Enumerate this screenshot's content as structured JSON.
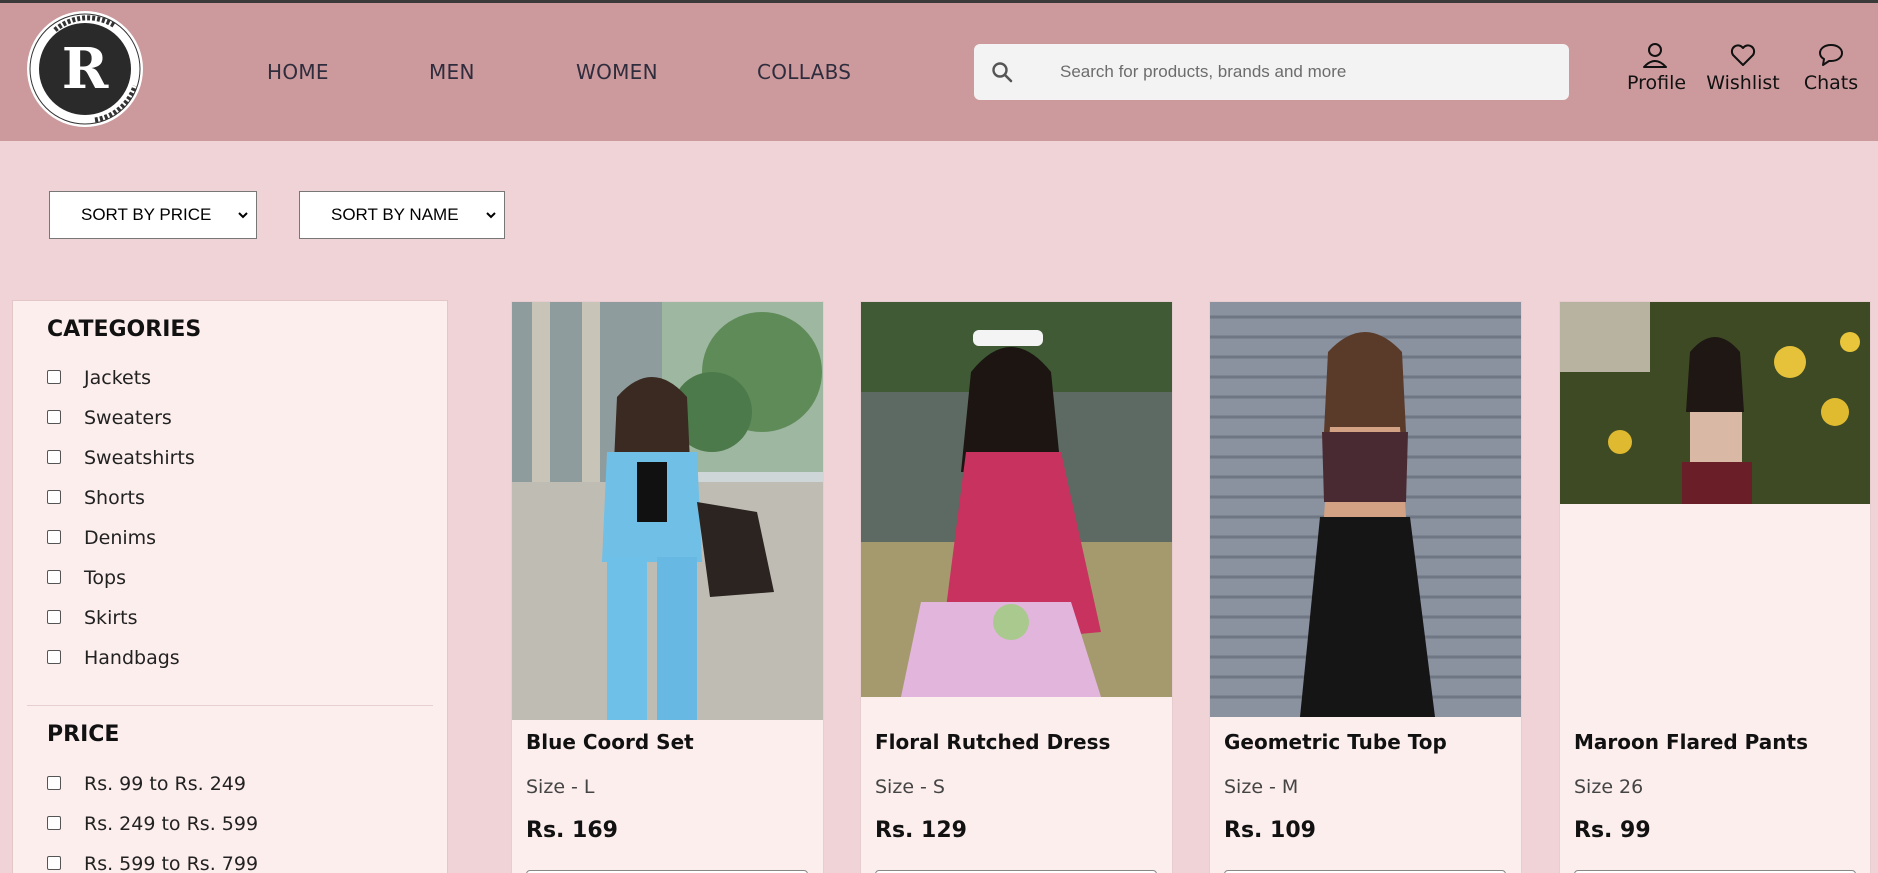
{
  "brand": {
    "logo_ring_text": "RENT|EARN|FLEX RENTTIRE",
    "logo_letter": "R"
  },
  "nav": [
    {
      "label": "HOME"
    },
    {
      "label": "MEN"
    },
    {
      "label": "WOMEN"
    },
    {
      "label": "COLLABS"
    }
  ],
  "search": {
    "placeholder": "Search for products, brands and more",
    "icon": "search-icon"
  },
  "header_actions": [
    {
      "label": "Profile",
      "icon": "user-icon"
    },
    {
      "label": "Wishlist",
      "icon": "heart-icon"
    },
    {
      "label": "Chats",
      "icon": "chat-bubble-icon"
    }
  ],
  "sort": {
    "price_label": "SORT BY PRICE",
    "name_label": "SORT BY NAME"
  },
  "filters": {
    "categories_title": "CATEGORIES",
    "categories": [
      "Jackets",
      "Sweaters",
      "Sweatshirts",
      "Shorts",
      "Denims",
      "Tops",
      "Skirts",
      "Handbags"
    ],
    "price_title": "PRICE",
    "prices": [
      "Rs. 99 to Rs. 249",
      "Rs. 249 to Rs. 599",
      "Rs. 599 to Rs. 799"
    ]
  },
  "products": [
    {
      "name": "Blue Coord Set",
      "size": "Size - L",
      "price": "Rs. 169"
    },
    {
      "name": "Floral Rutched Dress",
      "size": "Size - S",
      "price": "Rs. 129"
    },
    {
      "name": "Geometric Tube Top",
      "size": "Size - M",
      "price": "Rs. 109"
    },
    {
      "name": "Maroon Flared Pants",
      "size": "Size 26",
      "price": "Rs. 99"
    }
  ],
  "colors": {
    "header": "#cc9a9d",
    "page": "#efd3d6",
    "card": "#fdeeee"
  }
}
